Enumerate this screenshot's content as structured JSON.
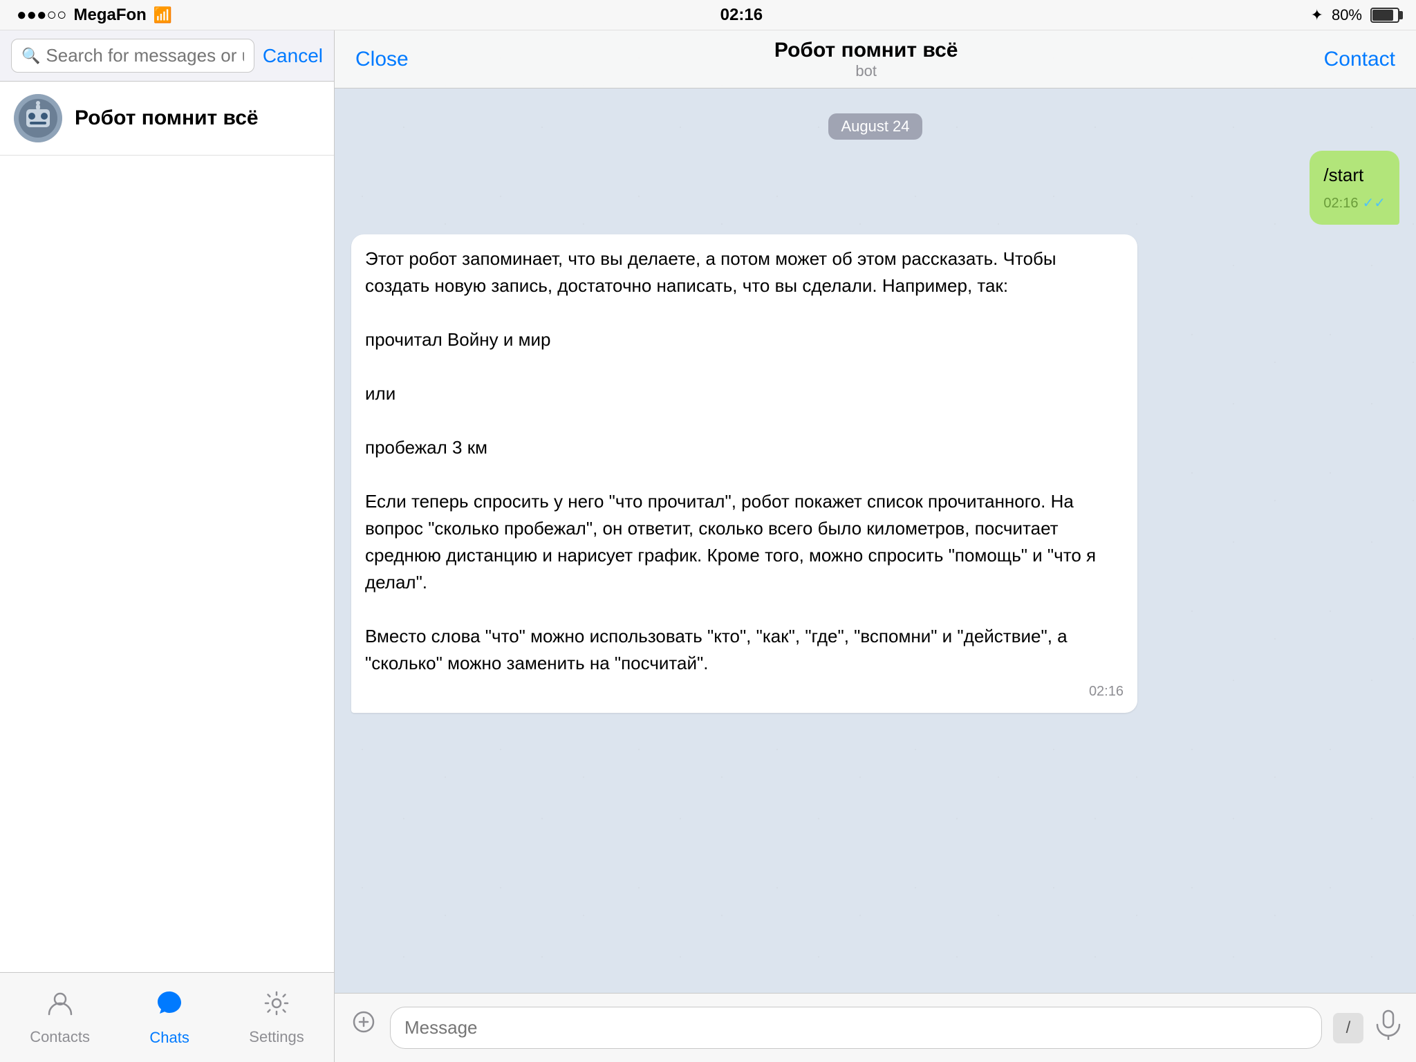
{
  "status_bar": {
    "carrier": "MegaFon",
    "time": "02:16",
    "battery": "80%",
    "bluetooth": "✦"
  },
  "search": {
    "placeholder": "Search for messages or users",
    "cancel_label": "Cancel"
  },
  "chat_list": [
    {
      "name": "Робот помнит всё",
      "avatar_label": "🤖"
    }
  ],
  "tab_bar": {
    "tabs": [
      {
        "id": "contacts",
        "label": "Contacts",
        "icon": "👤",
        "active": false
      },
      {
        "id": "chats",
        "label": "Chats",
        "icon": "💬",
        "active": true
      },
      {
        "id": "settings",
        "label": "Settings",
        "icon": "⚙️",
        "active": false
      }
    ]
  },
  "chat_header": {
    "close_label": "Close",
    "name": "Робот помнит всё",
    "subtitle": "bot",
    "contact_label": "Contact"
  },
  "messages": {
    "date_separator": "August 24",
    "outgoing": [
      {
        "text": "/start",
        "time": "02:16",
        "ticks": "✓✓"
      }
    ],
    "incoming": [
      {
        "text": "Этот робот запоминает, что вы делаете, а потом может об этом рассказать. Чтобы создать новую запись, достаточно написать, что вы сделали. Например, так:\n\nпрочитал Войну и мир\n\nили\n\nпробежал 3 км\n\nЕсли теперь спросить у него \"что прочитал\", робот покажет список прочитанного. На вопрос \"сколько пробежал\", он ответит, сколько всего было километров, посчитает среднюю дистанцию и нарисует график. Кроме того, можно спросить \"помощь\" и \"что я делал\".\n\nВместо слова \"что\" можно использовать \"кто\", \"как\", \"где\", \"вспомни\" и \"действие\", а \"сколько\" можно заменить на \"посчитай\".",
        "time": "02:16"
      }
    ]
  },
  "input_bar": {
    "placeholder": "Message",
    "slash": "/",
    "attach_icon": "📎",
    "mic_icon": "🎙"
  }
}
